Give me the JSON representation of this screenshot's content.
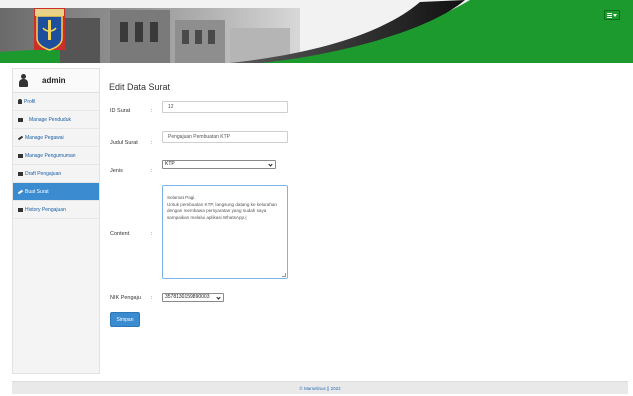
{
  "sidebar": {
    "user_name": "admin",
    "items": [
      {
        "label": "Profil",
        "icon": "user-icon"
      },
      {
        "label": "Manage Penduduk",
        "icon": "table-icon"
      },
      {
        "label": "Manage Pegawai",
        "icon": "pencil-icon"
      },
      {
        "label": "Manage Pengumuman",
        "icon": "list-icon"
      },
      {
        "label": "Draft Pengajuan",
        "icon": "document-icon"
      },
      {
        "label": "Buat Surat",
        "icon": "pencil-icon",
        "active": true
      },
      {
        "label": "History Pengajuan",
        "icon": "list-icon"
      }
    ]
  },
  "form": {
    "title": "Edit Data Surat",
    "colon": ":",
    "id_surat": {
      "label": "ID Surat",
      "value": "12"
    },
    "judul_surat": {
      "label": "Judul Surat",
      "value": "Pengajuan Pembuatan KTP"
    },
    "jenis": {
      "label": "Jenis",
      "value": "KTP"
    },
    "content": {
      "label": "Content",
      "value": "Selamat Pagi.\nUntuk pembuatan KTP, langsung datang ke kelurahan dengan membawa persyaratan yang sudah saya sampaikan melalui aplikasi WhatsApp.|"
    },
    "nik_pengaju": {
      "label": "NIK Pengaju",
      "value": "3578130159890003"
    },
    "submit_label": "Simpan"
  },
  "footer": {
    "text": "© Marselinus  || 2022"
  },
  "colors": {
    "accent": "#3a8bd0",
    "header_green": "#1c9a2e",
    "header_dark": "#222222"
  }
}
